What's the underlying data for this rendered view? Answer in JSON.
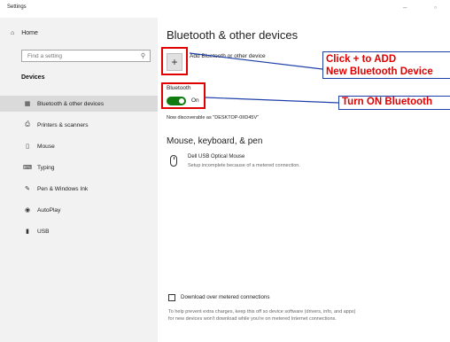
{
  "window": {
    "title": "Settings",
    "minimize_glyph": "–",
    "maximize_glyph": "▫"
  },
  "sidebar": {
    "home_label": "Home",
    "search_placeholder": "Find a setting",
    "section_label": "Devices",
    "items": [
      {
        "label": "Bluetooth & other devices",
        "icon": "bluetooth-devices-icon",
        "selected": true
      },
      {
        "label": "Printers & scanners",
        "icon": "printer-icon"
      },
      {
        "label": "Mouse",
        "icon": "mouse-icon"
      },
      {
        "label": "Typing",
        "icon": "keyboard-icon"
      },
      {
        "label": "Pen & Windows Ink",
        "icon": "pen-icon"
      },
      {
        "label": "AutoPlay",
        "icon": "autoplay-icon"
      },
      {
        "label": "USB",
        "icon": "usb-icon"
      }
    ]
  },
  "main": {
    "title": "Bluetooth & other devices",
    "add_button_glyph": "+",
    "add_label": "Add Bluetooth or other device",
    "bluetooth_label": "Bluetooth",
    "bluetooth_state": "On",
    "discoverable_text": "Now discoverable as \"DESKTOP-0IID45V\"",
    "section2_title": "Mouse, keyboard, & pen",
    "device": {
      "name": "Dell USB Optical Mouse",
      "status": "Setup incomplete because of a metered connection."
    },
    "metered_checkbox_label": "Download over metered connections",
    "metered_checked": false,
    "help_text": "To help prevent extra charges, keep this off so device software (drivers, info, and apps) for new devices won't download while you're on metered Internet connections."
  },
  "annotations": {
    "add_line1": "Click + to ADD",
    "add_line2": "New Bluetooth Device",
    "turn_on": "Turn ON Bluetooth",
    "highlight_color": "#e00000",
    "connector_color": "#1e3fa8"
  },
  "colors": {
    "toggle_on": "#107c10",
    "sidebar_bg": "#f2f2f2",
    "selected_bg": "#dadada"
  }
}
